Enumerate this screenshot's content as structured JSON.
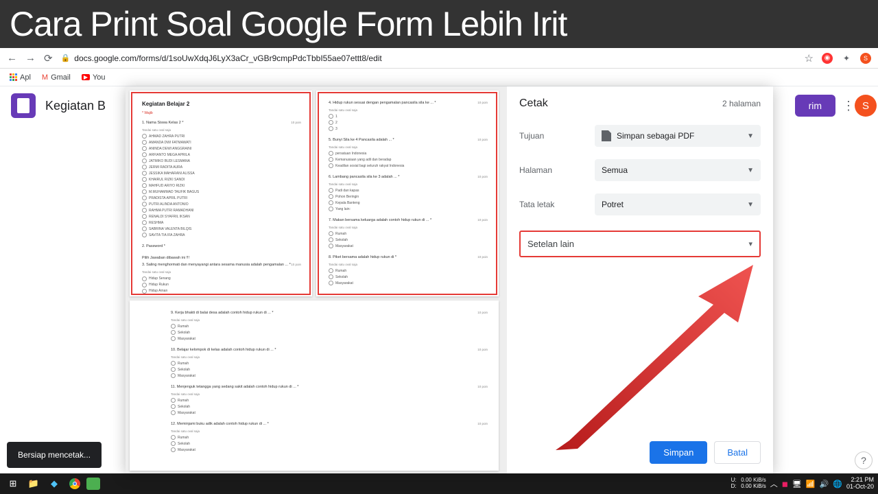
{
  "banner": "Cara Print Soal Google Form Lebih Irit",
  "browser": {
    "url": "docs.google.com/forms/d/1soUwXdqJ6LyX3aCr_vGBr9cmpPdcTbbI55ae07ettt8/edit",
    "star": "☆"
  },
  "bookmarks": {
    "apps": "Apl",
    "gmail": "Gmail",
    "youtube": "You"
  },
  "forms": {
    "title": "Kegiatan B",
    "send": "rim",
    "avatar": "S"
  },
  "preview": {
    "page1_title": "Kegiatan Belajar 2",
    "required": "* Wajib",
    "q1": "1.  Nama Siswa Kelas 2 *",
    "hint": "Tandai satu oval saja",
    "opts1": [
      "AHMAD ZAHRA PUTRI",
      "AMANDA DWI FATMAWATI",
      "ANINDA DEWI ANGGRAINI",
      "ARFIANTO MEGA APRILA",
      "JATMIKO BUDI LESMANA",
      "JERMI RADITA AURA",
      "JESSIKA MAHARANI ALISSA",
      "KHAIRUL RIZKI SANDI",
      "MAHFUD ARIYO RIZKI",
      "M.MUHAMMAD TAUFIK BAGUS",
      "PRADISTA APRIL PUTRI",
      "PUTRI ALINDA ANTONIO",
      "RAHMA PUTRI RAMADHANI",
      "RENALDI SYAFRIL IKSAN",
      "RESHMA",
      "SABRINA VALENTA BILQIS",
      "SAVITA TIA IFA ZAHRA"
    ],
    "q2": "2.  Password *",
    "q3_header": "Pilih Jawaban dibawah ini !!!",
    "q3": "3.  Saling menghormati dan menyayangi antara sesama manusia adalah pengamalan ... *",
    "opts3": [
      "Hidup Senang",
      "Hidup Rukun",
      "Hidup Aman"
    ],
    "q4": "4.  Hidup rukun sesuai dengan pengamalan pancasila sila ke ... *",
    "opts4": [
      "1",
      "2",
      "3"
    ],
    "q5": "5.  Bunyi Sila ke 4 Pancasila adalah ... *",
    "opts5": [
      "persatuan Indonesia",
      "Kemanusiaan yang adil dan beradap",
      "Keadilan sosial bagi seluruh rakyat Indonesia"
    ],
    "q6": "6.  Lambang pancasila sila ke 3 adalah ... *",
    "opts6": [
      "Padi dan kapas",
      "Pohon Beringin",
      "Kepala Banteng",
      "Yang lain:"
    ],
    "q7": "7.  Makan bersama keluarga adalah contoh hidup rukun di ... *",
    "opts7": [
      "Rumah",
      "Sekolah",
      "Masyarakat"
    ],
    "q8": "8.  Piket bersama adalah hidup rukun di *",
    "opts8": [
      "Rumah",
      "Sekolah",
      "Masyarakat"
    ],
    "q9": "9.  Kerja bhakti di balai desa adalah contoh hidup rukun di ... *",
    "opts9": [
      "Rumah",
      "Sekolah",
      "Masyarakat"
    ],
    "q10": "10. Belajar kelompok di kelas adalah contoh hidup rukun di ... *",
    "opts10": [
      "Rumah",
      "Sekolah",
      "Masyarakat"
    ],
    "q11": "11. Menjenguk tetangga yang sedang sakit adalah contoh hidup rukun di ... *",
    "opts11": [
      "Rumah",
      "Sekolah",
      "Masyarakat"
    ],
    "q12": "12. Meminjami buku adik adalah contoh hidup rukun di ... *",
    "opts12": [
      "Rumah",
      "Sekolah",
      "Masyarakat"
    ]
  },
  "print": {
    "title": "Cetak",
    "pages_info": "2 halaman",
    "dest_label": "Tujuan",
    "dest_value": "Simpan sebagai PDF",
    "pages_label": "Halaman",
    "pages_value": "Semua",
    "layout_label": "Tata letak",
    "layout_value": "Potret",
    "more_settings": "Setelan lain",
    "save": "Simpan",
    "cancel": "Batal"
  },
  "toast": "Bersiap mencetak...",
  "taskbar": {
    "up": "U:",
    "up_v": "0.00 KiB/s",
    "down": "D:",
    "down_v": "0.00 KiB/s",
    "time": "2:21 PM",
    "date": "01-Oct-20"
  }
}
